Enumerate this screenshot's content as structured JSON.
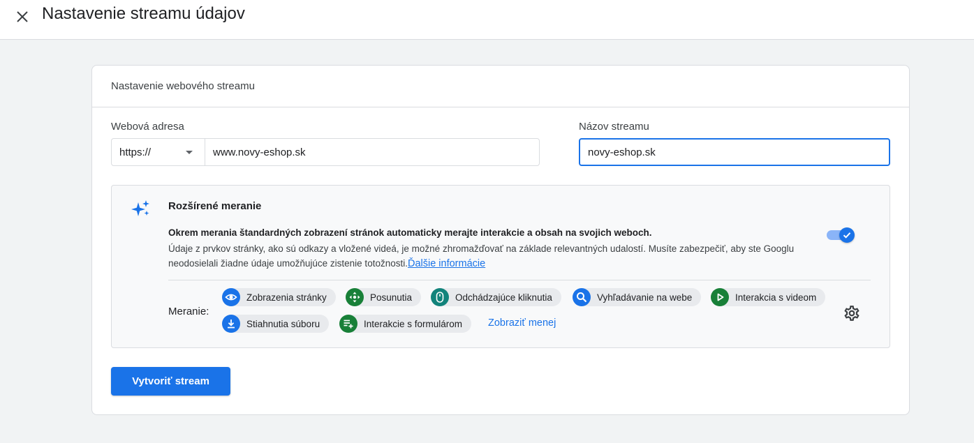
{
  "header": {
    "title": "Nastavenie streamu údajov",
    "close_icon": "close-icon"
  },
  "card": {
    "title": "Nastavenie webového streamu",
    "web_address": {
      "label": "Webová adresa",
      "protocol": "https://",
      "value": "www.novy-eshop.sk"
    },
    "stream_name": {
      "label": "Názov streamu",
      "value": "novy-eshop.sk"
    }
  },
  "enhanced": {
    "icon": "sparkle-icon",
    "title": "Rozšírené meranie",
    "bold": "Okrem merania štandardných zobrazení stránok automaticky merajte interakcie a obsah na svojich weboch.",
    "desc": "Údaje z prvkov stránky, ako sú odkazy a vložené videá, je možné zhromažďovať na základe relevantných udalostí. Musíte zabezpečiť, aby ste Googlu neodosielali žiadne údaje umožňujúce zistenie totožnosti.",
    "link": "Ďalšie informácie",
    "toggle_on": true,
    "measurement_label": "Meranie:",
    "chips": [
      {
        "label": "Zobrazenia stránky",
        "icon": "eye-icon",
        "color": "#1a73e8"
      },
      {
        "label": "Posunutia",
        "icon": "scroll-icon",
        "color": "#188038"
      },
      {
        "label": "Odchádzajúce kliknutia",
        "icon": "mouse-icon",
        "color": "#12837b"
      },
      {
        "label": "Vyhľadávanie na webe",
        "icon": "search-icon",
        "color": "#1a73e8"
      },
      {
        "label": "Interakcia s videom",
        "icon": "play-icon",
        "color": "#188038"
      },
      {
        "label": "Stiahnutia súboru",
        "icon": "download-icon",
        "color": "#1a73e8"
      },
      {
        "label": "Interakcie s formulárom",
        "icon": "form-add-icon",
        "color": "#188038"
      }
    ],
    "show_less": "Zobraziť menej",
    "settings_icon": "gear-icon"
  },
  "actions": {
    "create": "Vytvoriť stream"
  }
}
